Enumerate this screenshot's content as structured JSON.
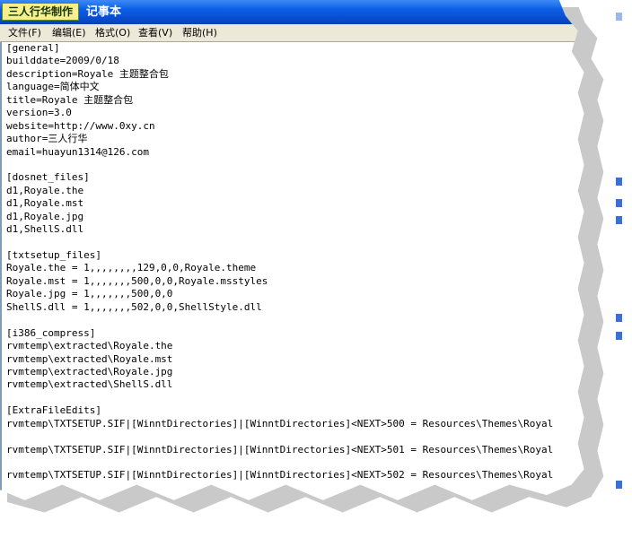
{
  "window": {
    "badge": "三人行华制作",
    "title": "记事本"
  },
  "menu": {
    "items": [
      {
        "label": "文件(F)"
      },
      {
        "label": "编辑(E)"
      },
      {
        "label": "格式(O)"
      },
      {
        "label": "查看(V)"
      },
      {
        "label": "帮助(H)"
      }
    ]
  },
  "document": {
    "lines": [
      "[general]",
      "builddate=2009/0/18",
      "description=Royale 主题整合包",
      "language=简体中文",
      "title=Royale 主题整合包",
      "version=3.0",
      "website=http://www.0xy.cn",
      "author=三人行华",
      "email=huayun1314@126.com",
      "",
      "[dosnet_files]",
      "d1,Royale.the",
      "d1,Royale.mst",
      "d1,Royale.jpg",
      "d1,ShellS.dll",
      "",
      "[txtsetup_files]",
      "Royale.the = 1,,,,,,,,129,0,0,Royale.theme",
      "Royale.mst = 1,,,,,,,500,0,0,Royale.msstyles",
      "Royale.jpg = 1,,,,,,,500,0,0",
      "ShellS.dll = 1,,,,,,,502,0,0,ShellStyle.dll",
      "",
      "[i386_compress]",
      "rvmtemp\\extracted\\Royale.the",
      "rvmtemp\\extracted\\Royale.mst",
      "rvmtemp\\extracted\\Royale.jpg",
      "rvmtemp\\extracted\\ShellS.dll",
      "",
      "[ExtraFileEdits]",
      "rvmtemp\\TXTSETUP.SIF|[WinntDirectories]|[WinntDirectories]<NEXT>500 = Resources\\Themes\\Royal",
      "",
      "rvmtemp\\TXTSETUP.SIF|[WinntDirectories]|[WinntDirectories]<NEXT>501 = Resources\\Themes\\Royal",
      "",
      "rvmtemp\\TXTSETUP.SIF|[WinntDirectories]|[WinntDirectories]<NEXT>502 = Resources\\Themes\\Royal"
    ]
  },
  "colors": {
    "titlebar": "#0a5ee6",
    "menubar": "#ece9d8",
    "badge_bg": "#f7f08a"
  }
}
